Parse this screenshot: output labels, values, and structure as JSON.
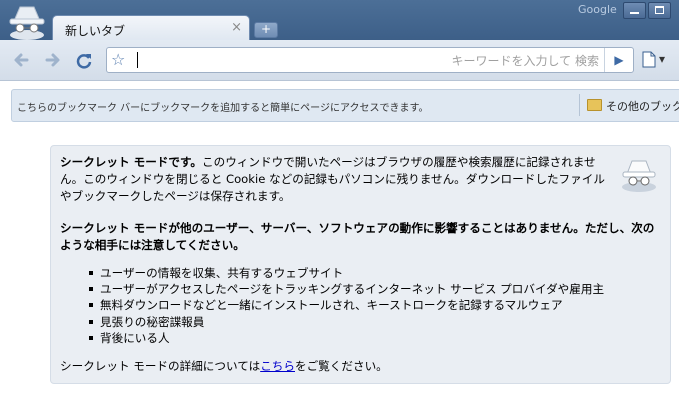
{
  "tab": {
    "title": "新しいタブ",
    "close": "×",
    "new_tab": "+"
  },
  "window": {
    "brand": "Google"
  },
  "toolbar": {
    "search_placeholder": "キーワードを入力して 検索",
    "go": "▶",
    "page_menu": "▾"
  },
  "bookmarks": {
    "message": "こちらのブックマーク バーにブックマークを追加すると簡単にページにアクセスできます。",
    "other": "その他のブックマ"
  },
  "incognito": {
    "p1_bold": "シークレット モードです。",
    "p1_rest": "このウィンドウで開いたページはブラウザの履歴や検索履歴に記録されません。このウィンドウを閉じると Cookie などの記録もパソコンに残りません。ダウンロードしたファイルやブックマークしたページは保存されます。",
    "p2": "シークレット モードが他のユーザー、サーバー、ソフトウェアの動作に影響することはありません。ただし、次のような相手には注意してください。",
    "items": [
      "ユーザーの情報を収集、共有するウェブサイト",
      "ユーザーがアクセスしたページをトラッキングするインターネット サービス プロバイダや雇用主",
      "無料ダウンロードなどと一緒にインストールされ、キーストロークを記録するマルウェア",
      "見張りの秘密諜報員",
      "背後にいる人"
    ],
    "footer_pre": "シークレット モードの詳細については",
    "footer_link": "こちら",
    "footer_post": "をご覧ください。"
  },
  "colors": {
    "frame": "#3d5f88",
    "infobox_bg": "#eaeef3",
    "link": "#0000cc"
  },
  "icons": [
    "incognito-icon",
    "back-icon",
    "forward-icon",
    "reload-icon",
    "star-icon",
    "go-icon",
    "page-icon",
    "folder-icon",
    "minimize-icon",
    "maximize-icon"
  ]
}
